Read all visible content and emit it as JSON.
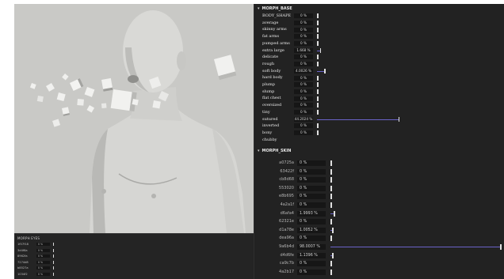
{
  "viewport": {
    "colors": {
      "background": "#c9c9c6",
      "skin": "#d6d6d3",
      "skin_shadow": "#a9a9a6",
      "cube_face": "#f1f1ef",
      "cube_side": "#b9b9b6"
    }
  },
  "eyes_panel": {
    "title": "MORPH EYES",
    "rows": [
      {
        "label": "1f07f18",
        "value": "0 %"
      },
      {
        "label": "3d4f6a",
        "value": "0 %"
      },
      {
        "label": "8962fa",
        "value": "0 %"
      },
      {
        "label": "7274d8",
        "value": "0 %"
      },
      {
        "label": "b8527a",
        "value": "0 %"
      },
      {
        "label": "1034f2",
        "value": "0 %"
      }
    ]
  },
  "morph_base": {
    "title": "MORPH_BASE",
    "accent_color": "#6a63c8",
    "rows": [
      {
        "label": "BODY_SHAPE",
        "value": "0 %",
        "fraction": 0
      },
      {
        "label": "average",
        "value": "0 %",
        "fraction": 0
      },
      {
        "label": "skinny arms",
        "value": "0 %",
        "fraction": 0
      },
      {
        "label": "fat arms",
        "value": "0 %",
        "fraction": 0
      },
      {
        "label": "pumped arms",
        "value": "0 %",
        "fraction": 0
      },
      {
        "label": "extra large",
        "value": "1.668 %",
        "fraction": 0.0167
      },
      {
        "label": "delicate",
        "value": "0 %",
        "fraction": 0
      },
      {
        "label": "rough",
        "value": "0 %",
        "fraction": 0
      },
      {
        "label": "soft body",
        "value": "4.0026 %",
        "fraction": 0.04
      },
      {
        "label": "hard body",
        "value": "0 %",
        "fraction": 0
      },
      {
        "label": "plump",
        "value": "0 %",
        "fraction": 0
      },
      {
        "label": "slump",
        "value": "0 %",
        "fraction": 0
      },
      {
        "label": "flat chest",
        "value": "0 %",
        "fraction": 0
      },
      {
        "label": "oversized",
        "value": "0 %",
        "fraction": 0
      },
      {
        "label": "tiny",
        "value": "0 %",
        "fraction": 0
      },
      {
        "label": "sutured",
        "value": "44.2024 %",
        "fraction": 0.442
      },
      {
        "label": "inverted",
        "value": "0 %",
        "fraction": 0
      },
      {
        "label": "bony",
        "value": "0 %",
        "fraction": 0
      },
      {
        "label": "chubby",
        "value": "",
        "fraction": null
      }
    ]
  },
  "morph_skin": {
    "title": "MORPH_SKIN",
    "rows": [
      {
        "label": "a0725a",
        "value": "0 %",
        "fraction": 0
      },
      {
        "label": "63422f",
        "value": "0 %",
        "fraction": 0
      },
      {
        "label": "cb8d68",
        "value": "0 %",
        "fraction": 0
      },
      {
        "label": "553020",
        "value": "0 %",
        "fraction": 0
      },
      {
        "label": "e8b695",
        "value": "0 %",
        "fraction": 0
      },
      {
        "label": "4a2a1f",
        "value": "0 %",
        "fraction": 0
      },
      {
        "label": "d6afa4",
        "value": "1.9993 %",
        "fraction": 0.02
      },
      {
        "label": "62321e",
        "value": "0 %",
        "fraction": 0
      },
      {
        "label": "d1a78e",
        "value": "1.0052 %",
        "fraction": 0.01
      },
      {
        "label": "dea96a",
        "value": "0 %",
        "fraction": 0
      },
      {
        "label": "9a6b4d",
        "value": "98.0007 %",
        "fraction": 0.98
      },
      {
        "label": "d4d6fe",
        "value": "1.1396 %",
        "fraction": 0.0114
      },
      {
        "label": "ca9c7b",
        "value": "0 %",
        "fraction": 0
      },
      {
        "label": "4a2b17",
        "value": "0 %",
        "fraction": 0
      }
    ]
  }
}
